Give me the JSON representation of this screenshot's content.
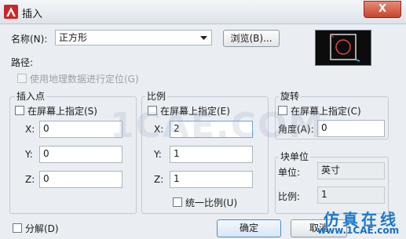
{
  "window": {
    "title": "插入",
    "close_glyph": "X"
  },
  "name": {
    "label": "名称(N):",
    "value": "正方形"
  },
  "browse_button": "浏览(B)...",
  "path": {
    "label": "路径:"
  },
  "geo": {
    "label": "使用地理数据进行定位(G)",
    "checked": false,
    "enabled": false
  },
  "insertion": {
    "title": "插入点",
    "specify_label": "在屏幕上指定(S)",
    "x_label": "X:",
    "x_value": "0",
    "y_label": "Y:",
    "y_value": "0",
    "z_label": "Z:",
    "z_value": "0"
  },
  "scale": {
    "title": "比例",
    "specify_label": "在屏幕上指定(E)",
    "x_label": "X:",
    "x_value": "2",
    "y_label": "Y:",
    "y_value": "1",
    "z_label": "Z:",
    "z_value": "1",
    "uniform_label": "统一比例(U)"
  },
  "rotation": {
    "title": "旋转",
    "specify_label": "在屏幕上指定(C)",
    "angle_label": "角度(A):",
    "angle_value": "0"
  },
  "block_unit": {
    "title": "块单位",
    "unit_label": "单位:",
    "unit_value": "英寸",
    "factor_label": "比例:",
    "factor_value": "1"
  },
  "explode": {
    "label": "分解(D)"
  },
  "buttons": {
    "ok": "确定",
    "cancel": "取消"
  },
  "watermark": {
    "big": "1CAE.COM",
    "text1": "仿真在线",
    "text2": "www.1CAE.com"
  },
  "icons": {
    "app": "autocad-logo-icon",
    "preview": "block-preview-icon"
  }
}
